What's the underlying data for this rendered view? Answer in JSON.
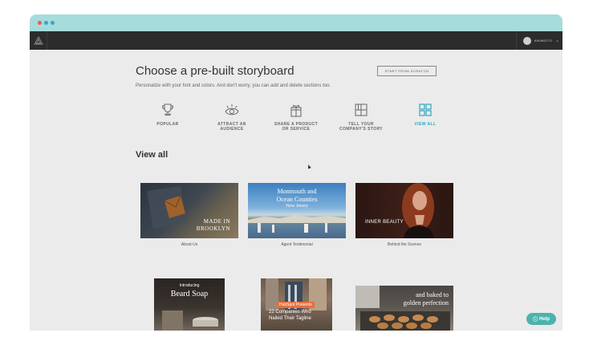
{
  "app": {
    "user_name": "ANIMOTO",
    "colors": {
      "accent": "#2aa6c0",
      "appbar": "#2c2c2c",
      "chrome": "#a7dcdc",
      "help": "#4cb3ac"
    }
  },
  "header": {
    "title": "Choose a pre-built storyboard",
    "subtitle": "Personalize with your font and colors. And don't worry, you can add and delete sections too.",
    "start_button": "START FROM SCRATCH"
  },
  "categories": [
    {
      "label": "POPULAR",
      "icon": "trophy-icon"
    },
    {
      "label": "ATTRACT AN AUDIENCE",
      "icon": "eye-icon"
    },
    {
      "label": "SHARE A PRODUCT OR SERVICE",
      "icon": "gift-icon"
    },
    {
      "label": "TELL YOUR COMPANY'S STORY",
      "icon": "storyboard-icon"
    },
    {
      "label": "VIEW ALL",
      "icon": "grid-icon",
      "active": true
    }
  ],
  "section_title": "View all",
  "cards": [
    {
      "caption": "About Us",
      "overlay": [
        "MADE IN",
        "BROOKLYN"
      ]
    },
    {
      "caption": "Agent Testimonial",
      "overlay": [
        "Monmouth and",
        "Ocean Counties",
        "New Jersey"
      ]
    },
    {
      "caption": "Behind the Scenes",
      "overlay": [
        "INNER BEAUTY"
      ]
    },
    {
      "caption": "",
      "overlay": [
        "Introducing",
        "Beard Soap"
      ]
    },
    {
      "caption": "",
      "overlay": [
        "HubSpot Presents",
        "22 Companies Who",
        "Nailed Their Tagline"
      ]
    },
    {
      "caption": "",
      "overlay": [
        "and baked to",
        "golden perfection"
      ]
    }
  ],
  "help_label": "Help"
}
